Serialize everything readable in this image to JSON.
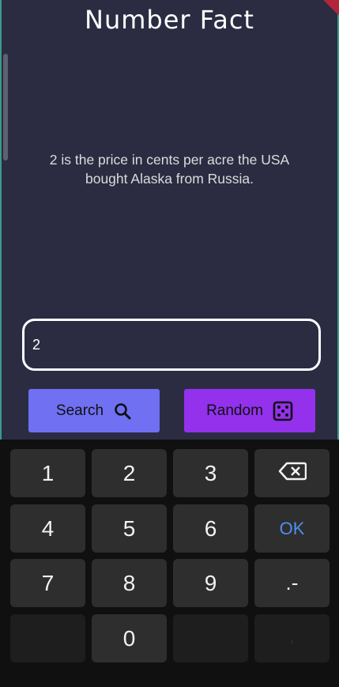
{
  "app": {
    "title": "Number Fact",
    "fact_text": "2 is the price in cents per acre the USA bought Alaska from Russia.",
    "number_input": {
      "value": "2",
      "placeholder": ""
    },
    "buttons": {
      "search": {
        "label": "Search",
        "icon": "search-icon",
        "color": "#6f70f2"
      },
      "random": {
        "label": "Random",
        "icon": "dice-icon",
        "color": "#9331ec"
      }
    }
  },
  "keyboard": {
    "rows": [
      [
        "1",
        "2",
        "3",
        "backspace"
      ],
      [
        "4",
        "5",
        "6",
        "OK"
      ],
      [
        "7",
        "8",
        "9",
        ".-"
      ],
      [
        "",
        "0",
        "",
        ","
      ]
    ],
    "k1": "1",
    "k2": "2",
    "k3": "3",
    "k4": "4",
    "k5": "5",
    "k6": "6",
    "k7": "7",
    "k8": "8",
    "k9": "9",
    "k0": "0",
    "ok": "OK",
    "punct": ".-",
    "comma": ","
  }
}
